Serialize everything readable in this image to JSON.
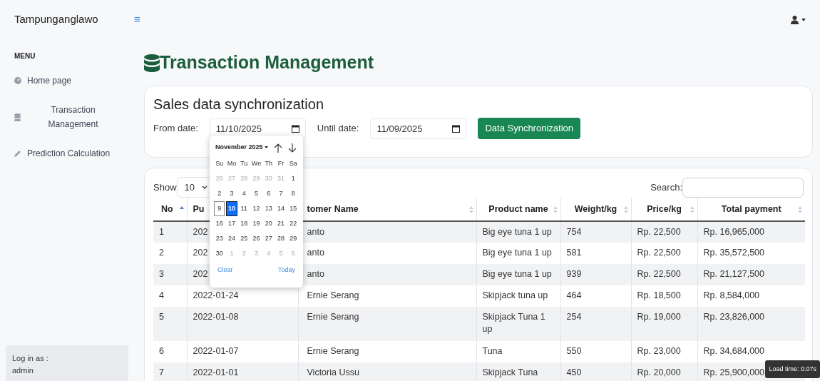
{
  "navbar": {
    "brand": "Tampunganglawo",
    "toggle": "≡"
  },
  "sidebar": {
    "heading": "MENU",
    "items": [
      {
        "label": "Home page"
      },
      {
        "label": "Transaction Management"
      },
      {
        "label": "Prediction Calculation"
      }
    ],
    "login_label": "Log in as :",
    "user": "admin"
  },
  "page": {
    "title": "Transaction Management"
  },
  "sync": {
    "title": "Sales data synchronization",
    "from_label": "From date:",
    "from_value": "11/10/2025",
    "until_label": "Until date:",
    "until_value": "11/09/2025",
    "button": "Data Synchronization"
  },
  "datepicker": {
    "month": "November 2025",
    "weekdays": [
      "Su",
      "Mo",
      "Tu",
      "We",
      "Th",
      "Fr",
      "Sa"
    ],
    "weeks": [
      [
        {
          "day": "26",
          "muted": true,
          "selected": false,
          "today": false
        },
        {
          "day": "27",
          "muted": true,
          "selected": false,
          "today": false
        },
        {
          "day": "28",
          "muted": true,
          "selected": false,
          "today": false
        },
        {
          "day": "29",
          "muted": true,
          "selected": false,
          "today": false
        },
        {
          "day": "30",
          "muted": true,
          "selected": false,
          "today": false
        },
        {
          "day": "31",
          "muted": true,
          "selected": false,
          "today": false
        },
        {
          "day": "1",
          "muted": false,
          "selected": false,
          "today": false
        }
      ],
      [
        {
          "day": "2",
          "muted": false,
          "selected": false,
          "today": false
        },
        {
          "day": "3",
          "muted": false,
          "selected": false,
          "today": false
        },
        {
          "day": "4",
          "muted": false,
          "selected": false,
          "today": false
        },
        {
          "day": "5",
          "muted": false,
          "selected": false,
          "today": false
        },
        {
          "day": "6",
          "muted": false,
          "selected": false,
          "today": false
        },
        {
          "day": "7",
          "muted": false,
          "selected": false,
          "today": false
        },
        {
          "day": "8",
          "muted": false,
          "selected": false,
          "today": false
        }
      ],
      [
        {
          "day": "9",
          "muted": false,
          "selected": false,
          "today": true
        },
        {
          "day": "10",
          "muted": false,
          "selected": true,
          "today": false
        },
        {
          "day": "11",
          "muted": false,
          "selected": false,
          "today": false
        },
        {
          "day": "12",
          "muted": false,
          "selected": false,
          "today": false
        },
        {
          "day": "13",
          "muted": false,
          "selected": false,
          "today": false
        },
        {
          "day": "14",
          "muted": false,
          "selected": false,
          "today": false
        },
        {
          "day": "15",
          "muted": false,
          "selected": false,
          "today": false
        }
      ],
      [
        {
          "day": "16",
          "muted": false,
          "selected": false,
          "today": false
        },
        {
          "day": "17",
          "muted": false,
          "selected": false,
          "today": false
        },
        {
          "day": "18",
          "muted": false,
          "selected": false,
          "today": false
        },
        {
          "day": "19",
          "muted": false,
          "selected": false,
          "today": false
        },
        {
          "day": "20",
          "muted": false,
          "selected": false,
          "today": false
        },
        {
          "day": "21",
          "muted": false,
          "selected": false,
          "today": false
        },
        {
          "day": "22",
          "muted": false,
          "selected": false,
          "today": false
        }
      ],
      [
        {
          "day": "23",
          "muted": false,
          "selected": false,
          "today": false
        },
        {
          "day": "24",
          "muted": false,
          "selected": false,
          "today": false
        },
        {
          "day": "25",
          "muted": false,
          "selected": false,
          "today": false
        },
        {
          "day": "26",
          "muted": false,
          "selected": false,
          "today": false
        },
        {
          "day": "27",
          "muted": false,
          "selected": false,
          "today": false
        },
        {
          "day": "28",
          "muted": false,
          "selected": false,
          "today": false
        },
        {
          "day": "29",
          "muted": false,
          "selected": false,
          "today": false
        }
      ],
      [
        {
          "day": "30",
          "muted": false,
          "selected": false,
          "today": false
        },
        {
          "day": "1",
          "muted": true,
          "selected": false,
          "today": false
        },
        {
          "day": "2",
          "muted": true,
          "selected": false,
          "today": false
        },
        {
          "day": "3",
          "muted": true,
          "selected": false,
          "today": false
        },
        {
          "day": "4",
          "muted": true,
          "selected": false,
          "today": false
        },
        {
          "day": "5",
          "muted": true,
          "selected": false,
          "today": false
        },
        {
          "day": "6",
          "muted": true,
          "selected": false,
          "today": false
        }
      ]
    ],
    "clear": "Clear",
    "today": "Today"
  },
  "table": {
    "show_label": "Show",
    "page_size": "10",
    "search_label": "Search:",
    "columns": [
      {
        "label": "No",
        "sorted": true
      },
      {
        "label": "Pu"
      },
      {
        "label": "tomer Name",
        "sorted": false
      },
      {
        "label": "Product name",
        "sorted": false
      },
      {
        "label": "Weight/kg",
        "sorted": false
      },
      {
        "label": "Price/kg",
        "sorted": false
      },
      {
        "label": "Total payment",
        "sorted": false
      }
    ],
    "rows": [
      [
        "1",
        "202",
        "anto",
        "Big eye tuna 1 up",
        "754",
        "Rp. 22,500",
        "Rp. 16,965,000"
      ],
      [
        "2",
        "202",
        "anto",
        "Big eye tuna 1 up",
        "581",
        "Rp. 22,500",
        "Rp. 35,572,500"
      ],
      [
        "3",
        "202",
        "anto",
        "Big eye tuna 1 up",
        "939",
        "Rp. 22,500",
        "Rp. 21,127,500"
      ],
      [
        "4",
        "2022-01-24",
        "Ernie Serang",
        "Skipjack tuna up",
        "464",
        "Rp. 18,500",
        "Rp. 8,584,000"
      ],
      [
        "5",
        "2022-01-08",
        "Ernie Serang",
        "Skipjack Tuna 1 up",
        "254",
        "Rp. 19,000",
        "Rp. 23,826,000"
      ],
      [
        "6",
        "2022-01-07",
        "Ernie Serang",
        "Tuna",
        "550",
        "Rp. 23,000",
        "Rp. 34,684,000"
      ],
      [
        "7",
        "2022-01-01",
        "Victoria Ussu",
        "Skipjack Tuna",
        "450",
        "Rp. 20,000",
        "Rp. 25,900,000"
      ]
    ]
  },
  "load_time": "Load time: 0.07s"
}
